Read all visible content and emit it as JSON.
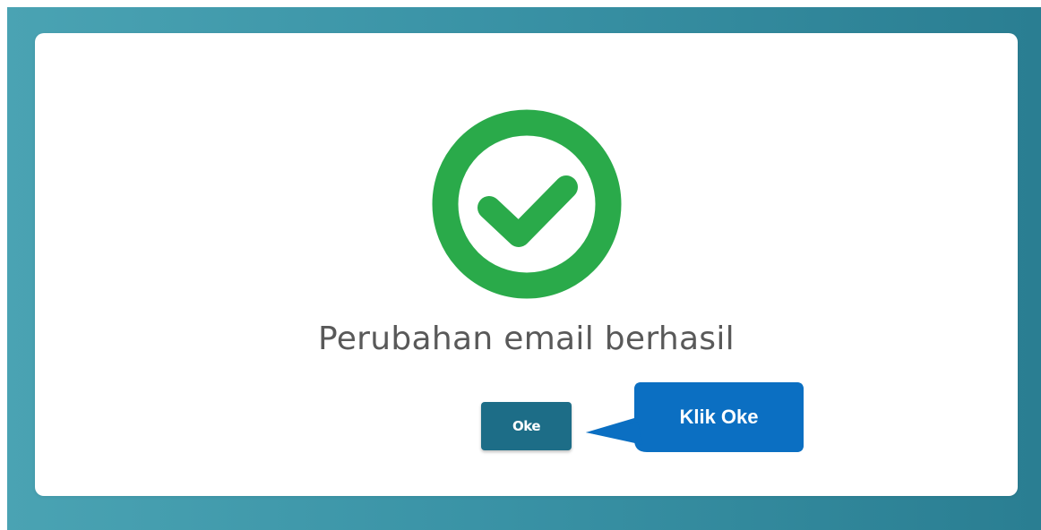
{
  "dialog": {
    "message": "Perubahan email berhasil",
    "icon": "check-circle-icon",
    "ok_label": "Oke"
  },
  "callout": {
    "text": "Klik Oke"
  },
  "colors": {
    "background_left": "#4aa3b3",
    "background_right": "#2a7e92",
    "success_green": "#2aaa4a",
    "button": "#1d6d87",
    "callout": "#0b6fc2",
    "message_text": "#595959"
  }
}
